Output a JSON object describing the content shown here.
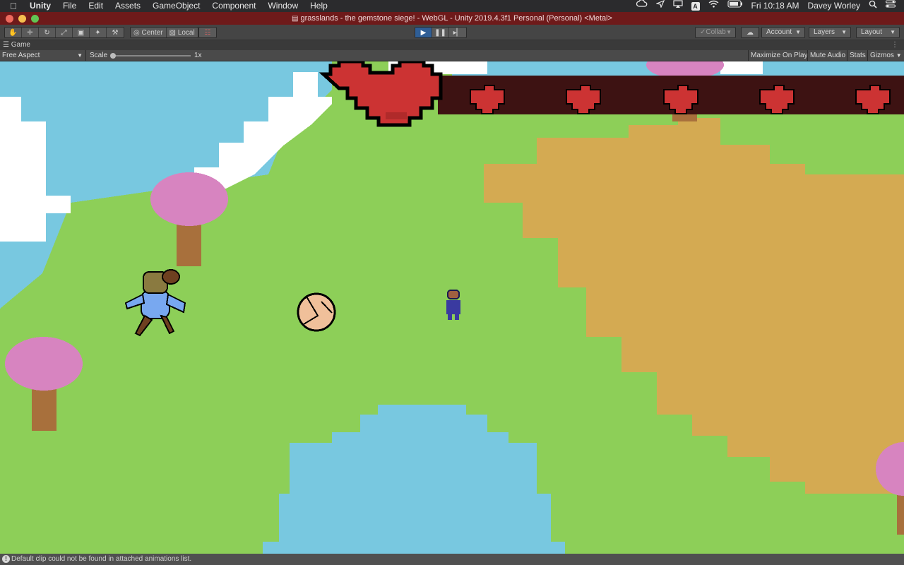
{
  "menubar": {
    "apple_icon": "apple-icon",
    "app_name": "Unity",
    "items": [
      "File",
      "Edit",
      "Assets",
      "GameObject",
      "Component",
      "Window",
      "Help"
    ],
    "clock": "Fri 10:18 AM",
    "user": "Davey Worley",
    "status_icons": [
      "creative-cloud-icon",
      "send-icon",
      "airplay-icon",
      "input-source-icon",
      "wifi-icon",
      "battery-icon"
    ],
    "input_source": "A"
  },
  "window": {
    "title": "grasslands - the gemstone siege! - WebGL - Unity 2019.4.3f1 Personal (Personal) <Metal>",
    "colors": {
      "close": "#ed6a5e",
      "minimize": "#f5bf4f",
      "zoom": "#61c554",
      "bar": "#6e1a1a"
    }
  },
  "toolbar": {
    "transform_tools": [
      "hand-tool-icon",
      "move-tool-icon",
      "rotate-tool-icon",
      "scale-tool-icon",
      "rect-tool-icon",
      "transform-tool-icon",
      "custom-tool-icon"
    ],
    "pivot_label": "Center",
    "space_label": "Local",
    "collab_label": "Collab",
    "account_label": "Account",
    "layers_label": "Layers",
    "layout_label": "Layout",
    "play_active": true
  },
  "game_tab": {
    "label": "Game",
    "aspect": "Free Aspect",
    "scale_label": "Scale",
    "scale_value": "1x",
    "buttons": [
      "Maximize On Play",
      "Mute Audio",
      "Stats",
      "Gizmos"
    ]
  },
  "scene": {
    "hearts_hud": {
      "big_heart": 1,
      "small_hearts": 5
    },
    "colors": {
      "sky": "#78c8e0",
      "grass": "#8dcf58",
      "sand": "#d4aa52",
      "water": "#78c8e0",
      "cloud": "#ffffff",
      "blossom": "#d784c0",
      "trunk": "#a8703c",
      "heart": "#cc3333",
      "hud_bar": "#3d1212"
    }
  },
  "status": {
    "message": "Default clip could not be found in attached animations list."
  }
}
